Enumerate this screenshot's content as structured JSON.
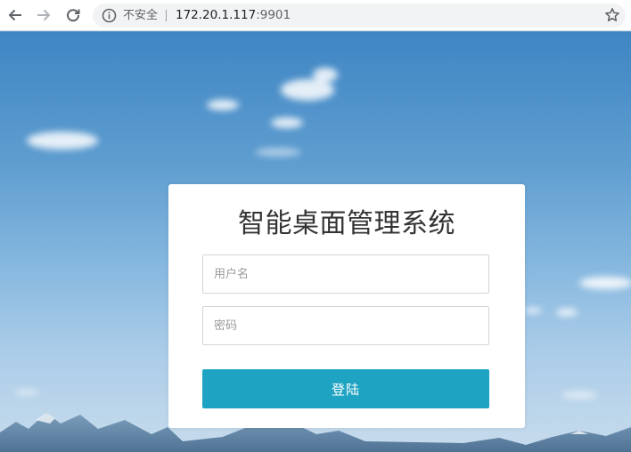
{
  "browser": {
    "security_label": "不安全",
    "url_host": "172.20.1.117",
    "url_port": ":9901"
  },
  "login": {
    "title": "智能桌面管理系统",
    "username_placeholder": "用户名",
    "password_placeholder": "密码",
    "submit_label": "登陆"
  },
  "colors": {
    "button": "#1fa3c2",
    "sky_top": "#3f86c4",
    "sky_bottom": "#c8dcec"
  }
}
